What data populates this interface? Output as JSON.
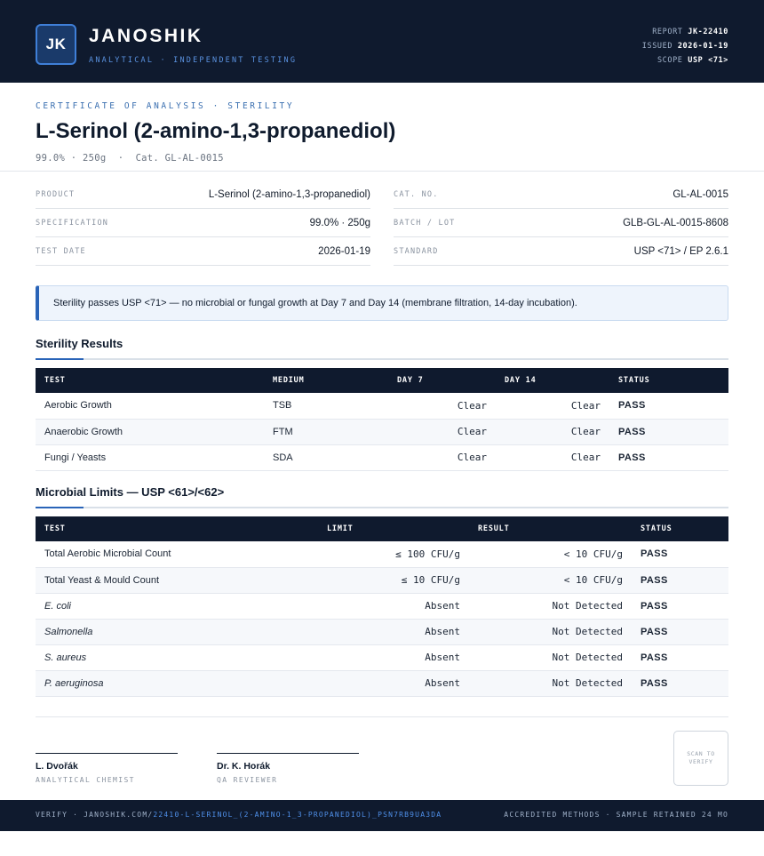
{
  "header": {
    "logo": "JK",
    "brand": "JANOSHIK",
    "tagline": "ANALYTICAL · INDEPENDENT TESTING",
    "report_label": "REPORT",
    "report_value": "JK-22410",
    "issued_label": "ISSUED",
    "issued_value": "2026-01-19",
    "scope_label": "SCOPE",
    "scope_value": "USP <71>"
  },
  "doc": {
    "eyebrow": "CERTIFICATE OF ANALYSIS · STERILITY",
    "title": "L-Serinol (2-amino-1,3-propanediol)",
    "subtitle": "99.0% · 250g  ·  Cat. GL-AL-0015"
  },
  "info": {
    "product_label": "PRODUCT",
    "product_value": "L-Serinol (2-amino-1,3-propanediol)",
    "spec_label": "SPECIFICATION",
    "spec_value": "99.0% · 250g",
    "date_label": "TEST DATE",
    "date_value": "2026-01-19",
    "cat_label": "CAT. NO.",
    "cat_value": "GL-AL-0015",
    "batch_label": "BATCH / LOT",
    "batch_value": "GLB-GL-AL-0015-8608",
    "standard_label": "STANDARD",
    "standard_value": "USP <71> / EP 2.6.1"
  },
  "callout": "Sterility passes USP <71> — no microbial or fungal growth at Day 7 and Day 14 (membrane filtration, 14-day incubation).",
  "sterility": {
    "title": "Sterility Results",
    "headers": [
      "TEST",
      "MEDIUM",
      "DAY 7",
      "DAY 14",
      "STATUS"
    ],
    "rows": [
      {
        "test": "Aerobic Growth",
        "medium": "TSB",
        "day7": "Clear",
        "day14": "Clear",
        "status": "PASS"
      },
      {
        "test": "Anaerobic Growth",
        "medium": "FTM",
        "day7": "Clear",
        "day14": "Clear",
        "status": "PASS"
      },
      {
        "test": "Fungi / Yeasts",
        "medium": "SDA",
        "day7": "Clear",
        "day14": "Clear",
        "status": "PASS"
      }
    ]
  },
  "microbial": {
    "title": "Microbial Limits — USP <61>/<62>",
    "headers": [
      "TEST",
      "LIMIT",
      "RESULT",
      "STATUS"
    ],
    "rows": [
      {
        "test": "Total Aerobic Microbial Count",
        "limit": "≤ 100 CFU/g",
        "result": "< 10 CFU/g",
        "status": "PASS"
      },
      {
        "test": "Total Yeast & Mould Count",
        "limit": "≤ 10 CFU/g",
        "result": "< 10 CFU/g",
        "status": "PASS"
      },
      {
        "test": "E. coli",
        "limit": "Absent",
        "result": "Not Detected",
        "status": "PASS"
      },
      {
        "test": "Salmonella",
        "limit": "Absent",
        "result": "Not Detected",
        "status": "PASS"
      },
      {
        "test": "S. aureus",
        "limit": "Absent",
        "result": "Not Detected",
        "status": "PASS"
      },
      {
        "test": "P. aeruginosa",
        "limit": "Absent",
        "result": "Not Detected",
        "status": "PASS"
      }
    ]
  },
  "signatures": {
    "sig1_name": "L. Dvořák",
    "sig1_role": "ANALYTICAL CHEMIST",
    "sig2_name": "Dr. K. Horák",
    "sig2_role": "QA REVIEWER",
    "qr_text": "SCAN TO VERIFY"
  },
  "footer": {
    "verify_prefix": "VERIFY · JANOSHIK.COM/",
    "verify_link": "22410-L-SERINOL_(2-AMINO-1_3-PROPANEDIOL)_PSN7RB9UA3DA",
    "right": "ACCREDITED METHODS · SAMPLE RETAINED 24 MO"
  },
  "colors": {
    "navy": "#0f1a2e",
    "accent_blue": "#2a64b8",
    "pass_green": "#1f7a3a"
  }
}
